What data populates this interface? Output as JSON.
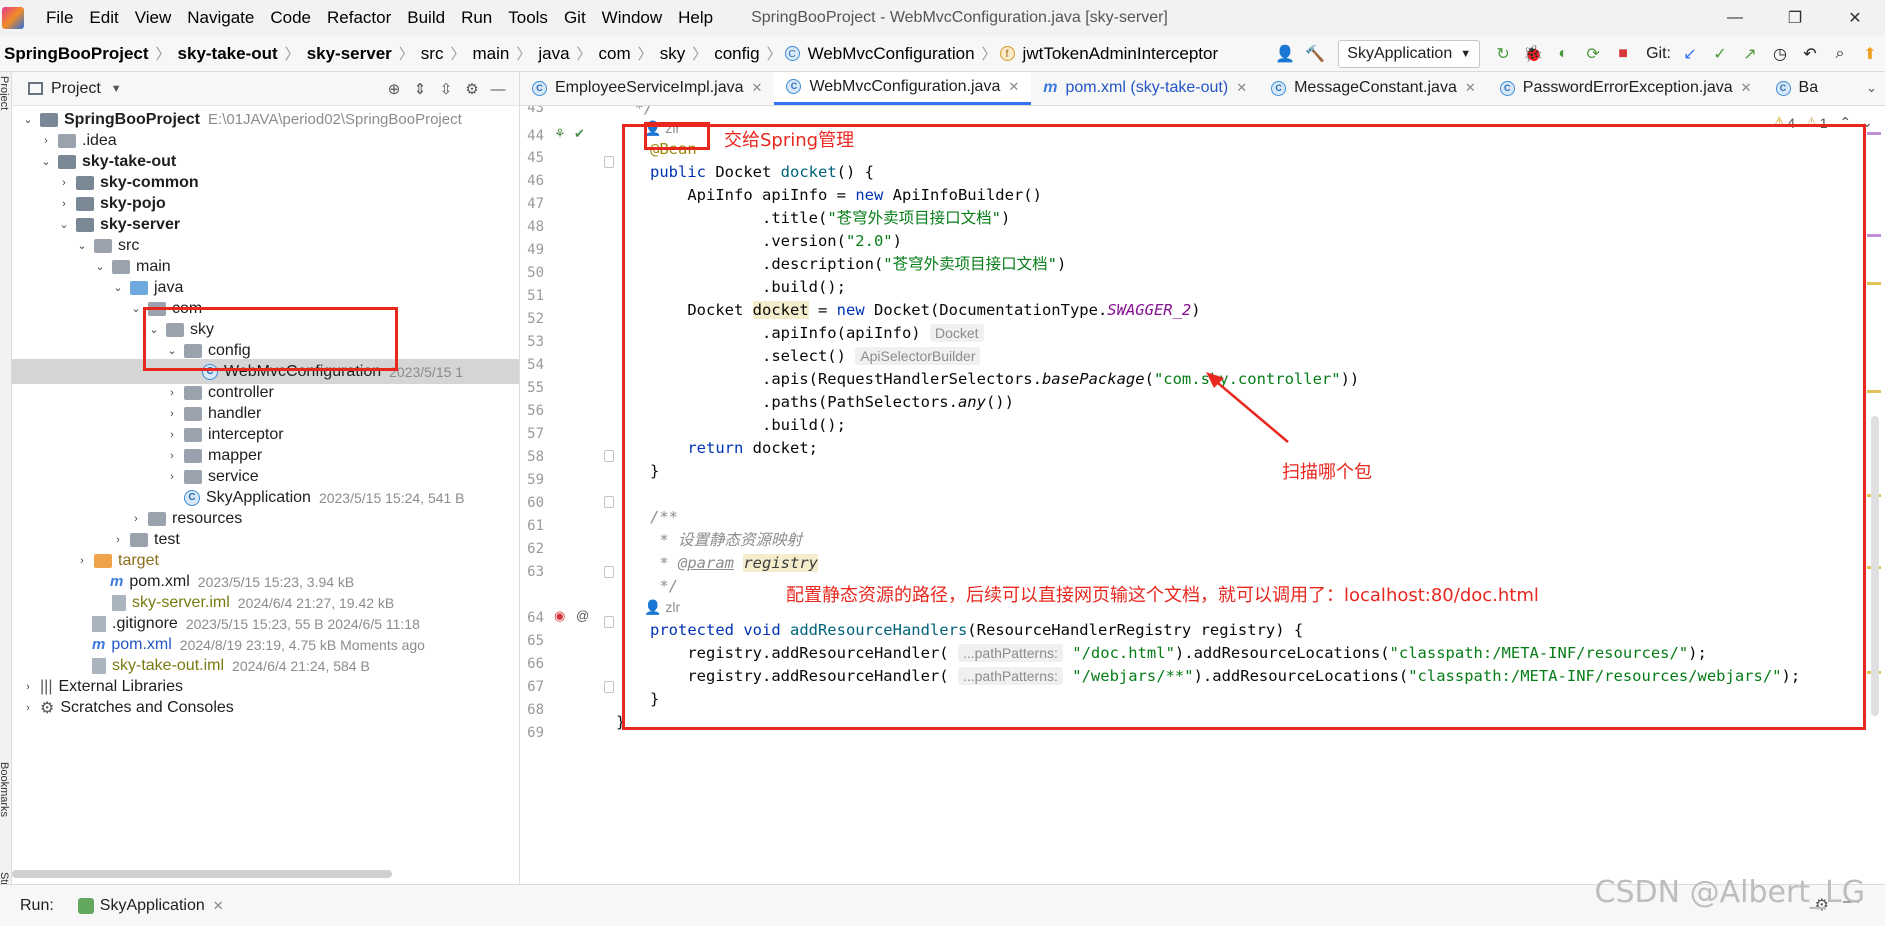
{
  "window": {
    "title": "SpringBooProject - WebMvcConfiguration.java [sky-server]",
    "menu": [
      "File",
      "Edit",
      "View",
      "Navigate",
      "Code",
      "Refactor",
      "Build",
      "Run",
      "Tools",
      "Git",
      "Window",
      "Help"
    ],
    "controls": [
      "—",
      "❐",
      "✕"
    ]
  },
  "breadcrumb": [
    "SpringBooProject",
    "sky-take-out",
    "sky-server",
    "src",
    "main",
    "java",
    "com",
    "sky",
    "config",
    "WebMvcConfiguration",
    "jwtTokenAdminInterceptor"
  ],
  "toolbar": {
    "run_config": "SkyApplication",
    "git_label": "Git:"
  },
  "left_strip": {
    "project": "Project",
    "bookmarks": "Bookmarks",
    "structure": "Structure"
  },
  "project_panel": {
    "title": "Project",
    "tree": [
      {
        "label": "SpringBooProject",
        "meta": "E:\\01JAVA\\period02\\SpringBooProject"
      },
      {
        "label": ".idea",
        "meta": ""
      },
      {
        "label": "sky-take-out",
        "meta": ""
      },
      {
        "label": "sky-common",
        "meta": ""
      },
      {
        "label": "sky-pojo",
        "meta": ""
      },
      {
        "label": "sky-server",
        "meta": ""
      },
      {
        "label": "src",
        "meta": ""
      },
      {
        "label": "main",
        "meta": ""
      },
      {
        "label": "java",
        "meta": ""
      },
      {
        "label": "com",
        "meta": ""
      },
      {
        "label": "sky",
        "meta": ""
      },
      {
        "label": "config",
        "meta": ""
      },
      {
        "label": "WebMvcConfiguration",
        "meta": "2023/5/15 1"
      },
      {
        "label": "controller",
        "meta": ""
      },
      {
        "label": "handler",
        "meta": ""
      },
      {
        "label": "interceptor",
        "meta": ""
      },
      {
        "label": "mapper",
        "meta": ""
      },
      {
        "label": "service",
        "meta": ""
      },
      {
        "label": "SkyApplication",
        "meta": "2023/5/15 15:24, 541 B"
      },
      {
        "label": "resources",
        "meta": ""
      },
      {
        "label": "test",
        "meta": ""
      },
      {
        "label": "target",
        "meta": ""
      },
      {
        "label": "pom.xml",
        "meta": "2023/5/15 15:23, 3.94 kB"
      },
      {
        "label": "sky-server.iml",
        "meta": "2024/6/4 21:27, 19.42 kB"
      },
      {
        "label": ".gitignore",
        "meta": "2023/5/15 15:23, 55 B 2024/6/5 11:18"
      },
      {
        "label": "pom.xml",
        "meta": "2024/8/19 23:19, 4.75 kB Moments ago"
      },
      {
        "label": "sky-take-out.iml",
        "meta": "2024/6/4 21:24, 584 B"
      },
      {
        "label": "External Libraries",
        "meta": ""
      },
      {
        "label": "Scratches and Consoles",
        "meta": ""
      }
    ]
  },
  "tabs": [
    {
      "label": "EmployeeServiceImpl.java"
    },
    {
      "label": "WebMvcConfiguration.java"
    },
    {
      "label": "pom.xml (sky-take-out)"
    },
    {
      "label": "MessageConstant.java"
    },
    {
      "label": "PasswordErrorException.java"
    },
    {
      "label": "Ba"
    }
  ],
  "problems": {
    "warnings": "4",
    "weak_warnings": "1"
  },
  "editor": {
    "line_numbers": [
      "43",
      "44",
      "45",
      "46",
      "47",
      "48",
      "49",
      "50",
      "51",
      "52",
      "53",
      "54",
      "55",
      "56",
      "57",
      "58",
      "59",
      "60",
      "61",
      "62",
      "63",
      "64",
      "65",
      "66",
      "67",
      "68",
      "69"
    ],
    "author": "zlr",
    "strings": {
      "title": "\"苍穹外卖项目接口文档\"",
      "version": "\"2.0\"",
      "description": "\"苍穹外卖项目接口文档\"",
      "package": "\"com.sky.controller\"",
      "doc_pattern": "\"/doc.html\"",
      "resources_loc": "\"classpath:/META-INF/resources/\"",
      "webjars_pattern": "\"/webjars/**\"",
      "webjars_loc": "\"classpath:/META-INF/resources/webjars/\""
    },
    "hints": {
      "docket": "Docket",
      "api_selector": "ApiSelectorBuilder",
      "path_patterns": "...pathPatterns:"
    },
    "comment_text": "设置静态资源映射",
    "param_tag": "@param",
    "param_name": "registry"
  },
  "annotations": {
    "bean_note": "交给Spring管理",
    "scan_note": "扫描哪个包",
    "static_note": "配置静态资源的路径，后续可以直接网页输这个文档，就可以调用了：localhost:80/doc.html"
  },
  "runbar": {
    "label": "Run:",
    "tab": "SkyApplication"
  },
  "watermark": "CSDN @Albert_LG",
  "colors": {
    "accent": "#3574f0",
    "annotation_red": "#e8281f",
    "keyword": "#0033b3",
    "string": "#067d17"
  }
}
